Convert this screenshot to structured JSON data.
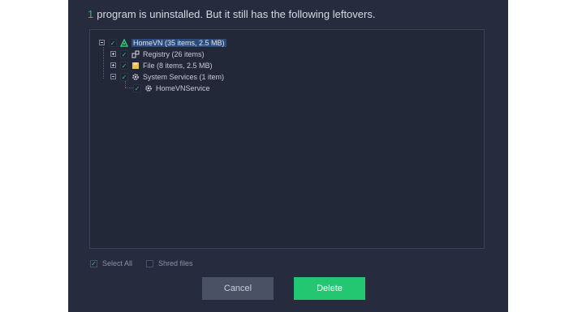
{
  "header": {
    "count": "1",
    "message": "program is uninstalled. But it still has the following leftovers."
  },
  "tree": {
    "root": {
      "label": "HomeVN (35 items, 2.5 MB)",
      "checked": true,
      "expanded": true,
      "icon": "app-icon"
    },
    "children": [
      {
        "label": "Registry (26 items)",
        "checked": true,
        "expanded": false,
        "icon": "registry-icon"
      },
      {
        "label": "File (8 items, 2.5 MB)",
        "checked": true,
        "expanded": false,
        "icon": "folder-icon"
      },
      {
        "label": "System Services (1 item)",
        "checked": true,
        "expanded": true,
        "icon": "gear-icon",
        "children": [
          {
            "label": "HomeVNService",
            "checked": true,
            "icon": "gear-icon"
          }
        ]
      }
    ]
  },
  "footer": {
    "select_all": {
      "label": "Select All",
      "checked": true
    },
    "shred_files": {
      "label": "Shred files",
      "checked": false
    }
  },
  "buttons": {
    "cancel": "Cancel",
    "delete": "Delete"
  },
  "colors": {
    "panel": "#262b3d",
    "accent": "#23c771",
    "selection": "#2c4a7a"
  }
}
